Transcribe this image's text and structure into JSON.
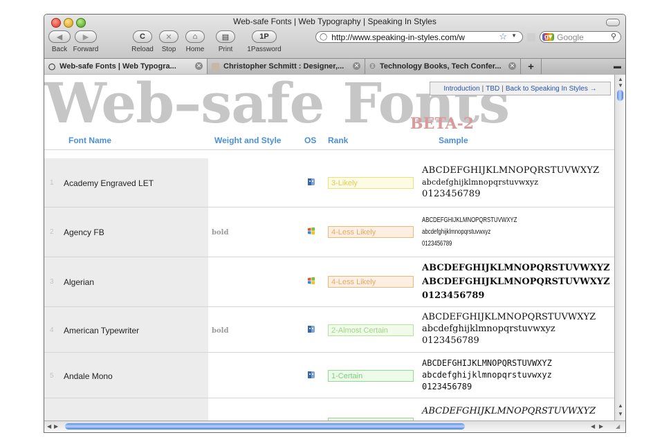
{
  "window": {
    "title": "Web-safe Fonts | Web Typography | Speaking In Styles"
  },
  "toolbar": {
    "back_label": "Back",
    "forward_label": "Forward",
    "reload_label": "Reload",
    "stop_label": "Stop",
    "home_label": "Home",
    "print_label": "Print",
    "password_label": "1Password",
    "password_glyph": "1P"
  },
  "address": {
    "url": "http://www.speaking-in-styles.com/w"
  },
  "search": {
    "placeholder": "Google"
  },
  "tabs": [
    {
      "label": "Web-safe Fonts | Web Typogra...",
      "active": true
    },
    {
      "label": "Christopher Schmitt : Designer,...",
      "active": false
    },
    {
      "label": "Technology Books, Tech Confer...",
      "active": false
    }
  ],
  "page": {
    "title": "Web–safe Fonts",
    "badge": "BETA-2",
    "nav": {
      "introduction": "Introduction",
      "tbd": "TBD",
      "back": "Back to Speaking In Styles →"
    },
    "columns": {
      "font_name": "Font Name",
      "weight_style": "Weight and Style",
      "os": "OS",
      "rank": "Rank",
      "sample": "Sample"
    },
    "rows": [
      {
        "num": "1",
        "name": "Academy Engraved LET",
        "weight": "",
        "os_icon": "mac-icon",
        "rank": "3-Likely",
        "rank_border": "#e8e27a",
        "rank_bg": "#fdfbe3",
        "rank_color": "#d8cf5c",
        "sample_lines": [
          "ABCDEFGHIJKLMNOPQRSTUVWXYZ",
          "abcdefghijklmnopqrstuvwxyz",
          "0123456789"
        ]
      },
      {
        "num": "2",
        "name": "Agency FB",
        "weight": "bold",
        "os_icon": "windows-icon",
        "rank": "4-Less Likely",
        "rank_border": "#f0b679",
        "rank_bg": "#fdf0e2",
        "rank_color": "#e9a764",
        "sample_lines": [
          "ABCDEFGHIJKLMNOPQRSTUVWXYZ",
          "abcdefghijklmnopqrstuvwxyz",
          "0123456789"
        ]
      },
      {
        "num": "3",
        "name": "Algerian",
        "weight": "",
        "os_icon": "windows-icon",
        "rank": "4-Less Likely",
        "rank_border": "#f0b679",
        "rank_bg": "#fdf0e2",
        "rank_color": "#e9a764",
        "sample_lines": [
          "ABCDEFGHIJKLMNOPQRSTUVWXYZ",
          "ABCDEFGHIJKLMNOPQRSTUVWXYZ",
          "0123456789"
        ]
      },
      {
        "num": "4",
        "name": "American Typewriter",
        "weight": "bold",
        "os_icon": "mac-icon",
        "rank": "2-Almost Certain",
        "rank_border": "#b3e59a",
        "rank_bg": "#f0fbe9",
        "rank_color": "#9fd685",
        "sample_lines": [
          "ABCDEFGHIJKLMNOPQRSTUVWXYZ",
          "abcdefghijklmnopqrstuvwxyz",
          "0123456789"
        ]
      },
      {
        "num": "5",
        "name": "Andale Mono",
        "weight": "",
        "os_icon": "mac-icon",
        "rank": "1-Certain",
        "rank_border": "#8fdc8a",
        "rank_bg": "#ecfbea",
        "rank_color": "#7ccf77",
        "sample_lines": [
          "ABCDEFGHIJKLMNOPQRSTUVWXYZ",
          "abcdefghijklmnopqrstuvwxyz",
          "0123456789"
        ]
      },
      {
        "num": "",
        "name": "",
        "weight": "",
        "os_icon": "",
        "rank": "",
        "rank_border": "#8fdc8a",
        "rank_bg": "#ecfbea",
        "rank_color": "#7ccf77",
        "sample_lines": [
          "ABCDEFGHIJKLMNOPQRSTUVWXYZ"
        ]
      }
    ]
  },
  "colors": {
    "accent": "#4a90d9",
    "title_gray": "#c6c6c6",
    "badge": "#d89a9a",
    "link": "#2653a8"
  }
}
